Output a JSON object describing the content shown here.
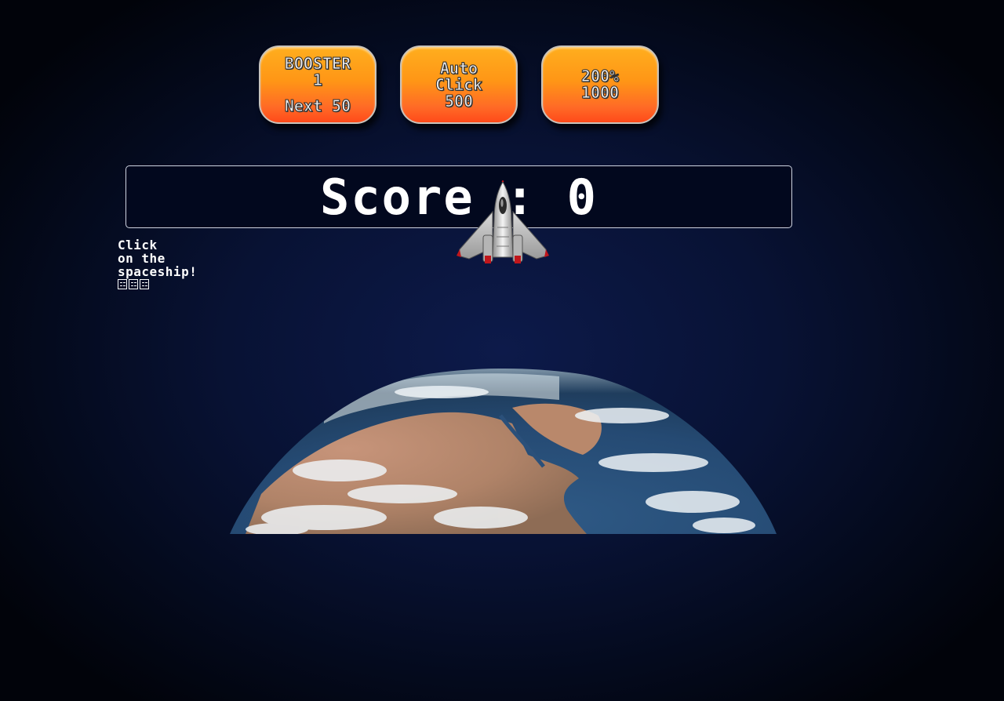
{
  "shop": {
    "booster": {
      "line1": "BOOSTER",
      "line2": "1",
      "line3": "Next 50"
    },
    "auto_click": {
      "line1": "Auto",
      "line2": "Click",
      "line3": "500"
    },
    "multiplier": {
      "line1": "200%",
      "line2": "1000"
    }
  },
  "score": {
    "label": "Score : 0"
  },
  "hint": {
    "line1": "Click",
    "line2": "on the",
    "line3": "spaceship!"
  },
  "colors": {
    "button_top": "#ffae1e",
    "button_bottom": "#ff4a1a",
    "background_center": "#0d1a4a",
    "background_edge": "#01030a",
    "score_border": "#cfd3e0"
  },
  "icons": {
    "spaceship": "spaceship-icon",
    "earth": "earth-image",
    "hint_glyphs": "unsupported-glyph-icon"
  }
}
